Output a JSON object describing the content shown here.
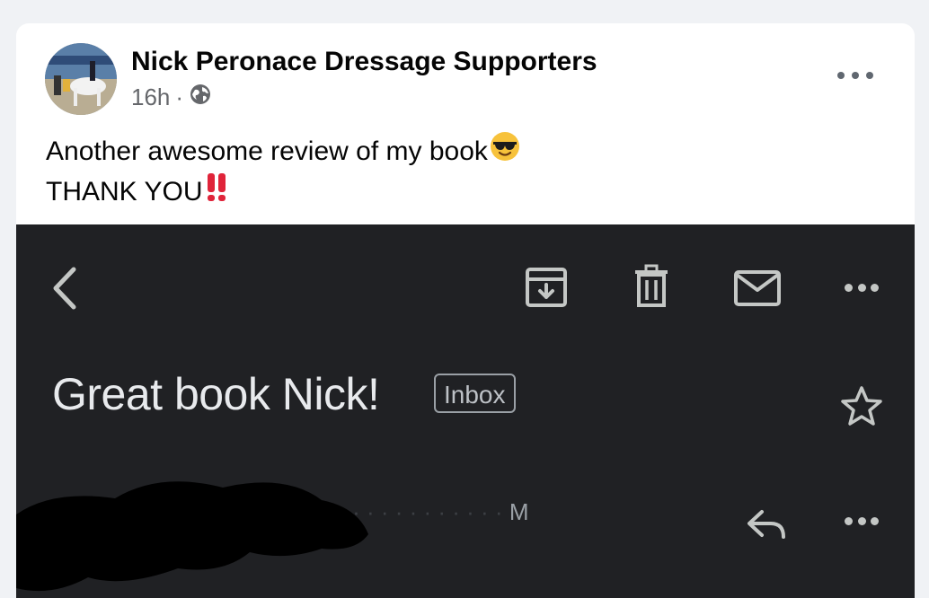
{
  "post": {
    "page_name": "Nick Peronace Dressage Supporters",
    "time_ago": "16h",
    "separator": "·",
    "audience_icon": "globe-icon",
    "menu_icon": "more-horizontal-icon",
    "text_line1": "Another awesome review of my book",
    "text_line1_emoji": "smiling-face-with-sunglasses-emoji",
    "text_line2": "THANK YOU",
    "text_line2_emoji": "double-exclamation-mark-emoji"
  },
  "email_screenshot": {
    "toolbar_icons": [
      "back-arrow-icon",
      "archive-icon",
      "trash-icon",
      "mark-unread-icon",
      "more-horizontal-icon"
    ],
    "subject": "Great book Nick!",
    "label_chip": "Inbox",
    "star_icon": "star-outline-icon",
    "sender_partial": "M",
    "reply_icon": "reply-icon",
    "row_menu_icon": "more-horizontal-icon"
  },
  "colors": {
    "page_bg": "#f0f2f5",
    "card_bg": "#ffffff",
    "primary_text": "#050505",
    "secondary_text": "#65676b",
    "email_dark_bg": "#202124",
    "email_text": "#e8eaed",
    "email_icon": "#c4c7c5"
  }
}
